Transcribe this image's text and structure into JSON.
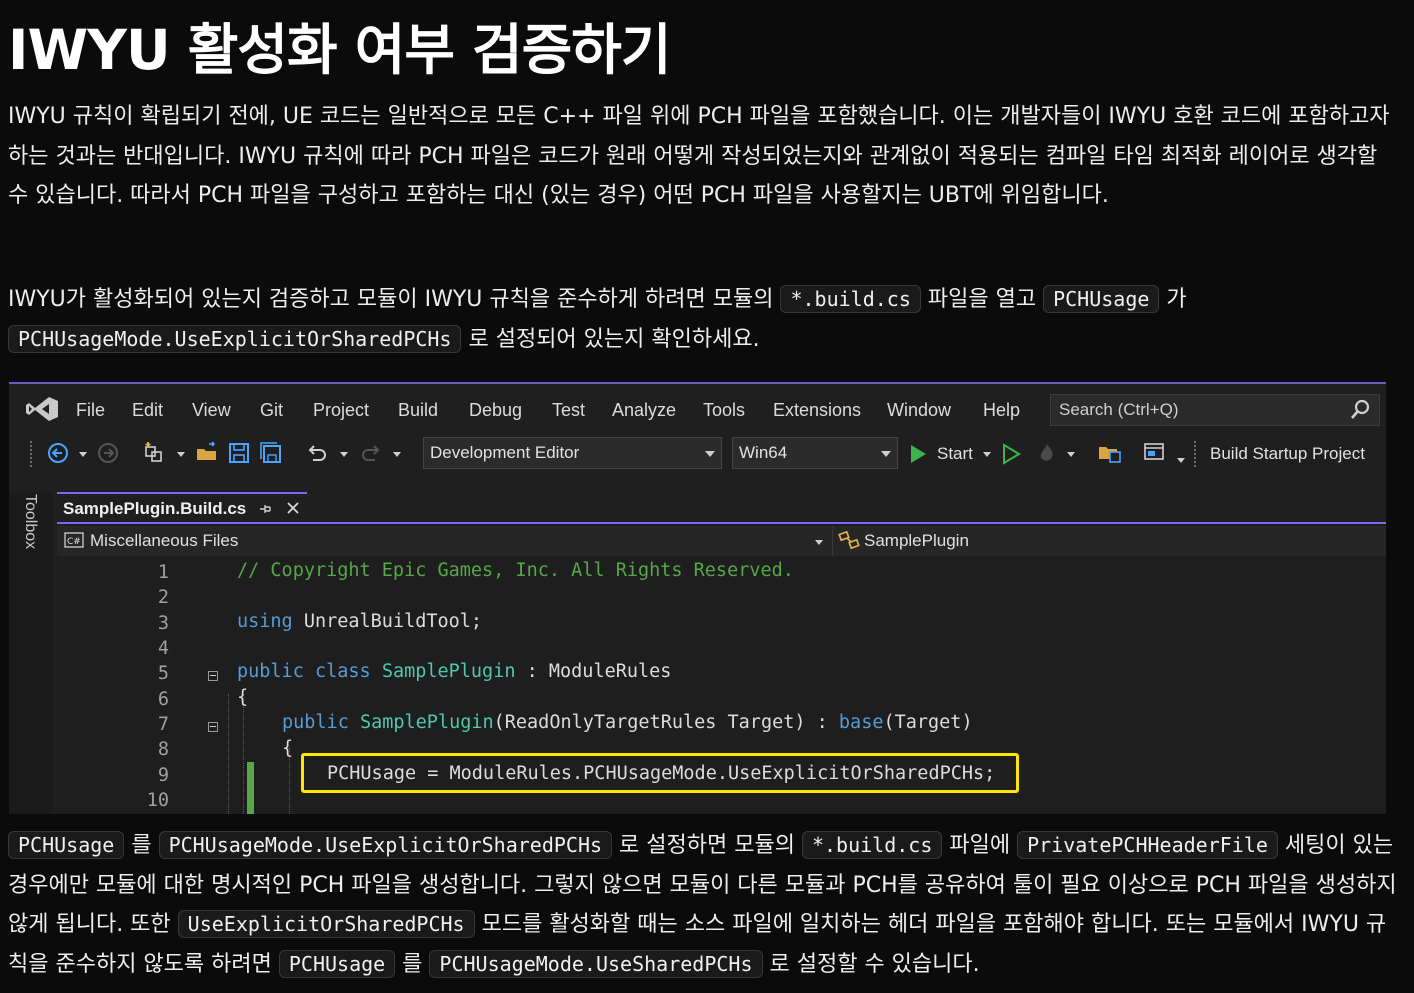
{
  "heading": "IWYU 활성화 여부 검증하기",
  "paragraph1": "IWYU 규칙이 확립되기 전에, UE 코드는 일반적으로 모든 C++ 파일 위에 PCH 파일을 포함했습니다. 이는 개발자들이 IWYU 호환 코드에 포함하고자 하는 것과는 반대입니다. IWYU 규칙에 따라 PCH 파일은 코드가 원래 어떻게 작성되었는지와 관계없이 적용되는 컴파일 타임 최적화 레이어로 생각할 수 있습니다. 따라서 PCH 파일을 구성하고 포함하는 대신 (있는 경우) 어떤 PCH 파일을 사용할지는 UBT에 위임합니다.",
  "paragraph2": {
    "t1": "IWYU가 활성화되어 있는지 검증하고 모듈이 IWYU 규칙을 준수하게 하려면 모듈의 ",
    "c1": "*.build.cs",
    "t2": " 파일을 열고 ",
    "c2": "PCHUsage",
    "t3": " 가 ",
    "c3": "PCHUsageMode.UseExplicitOrSharedPCHs",
    "t4": " 로 설정되어 있는지 확인하세요."
  },
  "paragraph3": {
    "c1": "PCHUsage",
    "t1": " 를 ",
    "c2": "PCHUsageMode.UseExplicitOrSharedPCHs",
    "t2": " 로 설정하면 모듈의 ",
    "c3": "*.build.cs",
    "t3": " 파일에 ",
    "c4": "PrivatePCHHeaderFile",
    "t4": " 세팅이 있는 경우에만 모듈에 대한 명시적인 PCH 파일을 생성합니다. 그렇지 않으면 모듈이 다른 모듈과 PCH를 공유하여 툴이 필요 이상으로 PCH 파일을 생성하지 않게 됩니다. 또한 ",
    "c5": "UseExplicitOrSharedPCHs",
    "t5": " 모드를 활성화할 때는 소스 파일에 일치하는 헤더 파일을 포함해야 합니다. 또는 모듈에서 IWYU 규칙을 준수하지 않도록 하려면 ",
    "c6": "PCHUsage",
    "t6": " 를 ",
    "c7": "PCHUsageMode.UseSharedPCHs",
    "t7": " 로 설정할 수 있습니다."
  },
  "ide": {
    "menu": [
      "File",
      "Edit",
      "View",
      "Git",
      "Project",
      "Build",
      "Debug",
      "Test",
      "Analyze",
      "Tools",
      "Extensions",
      "Window",
      "Help"
    ],
    "search_placeholder": "Search (Ctrl+Q)",
    "config": "Development Editor",
    "platform": "Win64",
    "start_label": "Start",
    "build_startup": "Build Startup Project",
    "toolbox_label": "Toolbox",
    "tab_title": "SamplePlugin.Build.cs",
    "nav_left": "Miscellaneous Files",
    "nav_right": "SamplePlugin",
    "line_numbers": [
      "1",
      "2",
      "3",
      "4",
      "5",
      "6",
      "7",
      "8",
      "9",
      "10"
    ],
    "code": {
      "l1": "// Copyright Epic Games, Inc. All Rights Reserved.",
      "l3_kw": "using",
      "l3_rest": " UnrealBuildTool;",
      "l5_kw1": "public",
      "l5_kw2": "class",
      "l5_type": "SamplePlugin",
      "l5_sep": " : ",
      "l5_base": "ModuleRules",
      "l6": "{",
      "l7_kw": "public",
      "l7_name": "SamplePlugin",
      "l7_p1": "(",
      "l7_type": "ReadOnlyTargetRules",
      "l7_arg": " Target",
      "l7_p2": ") : ",
      "l7_base": "base",
      "l7_p3": "(Target)",
      "l8": "{",
      "l9": "PCHUsage = ModuleRules.PCHUsageMode.UseExplicitOrSharedPCHs;"
    }
  },
  "colors": {
    "accent_purple": "#7b68ee",
    "highlight_yellow": "#ffe600",
    "comment_green": "#57a64a",
    "keyword_blue": "#569cd6",
    "type_teal": "#4ec9b0"
  }
}
